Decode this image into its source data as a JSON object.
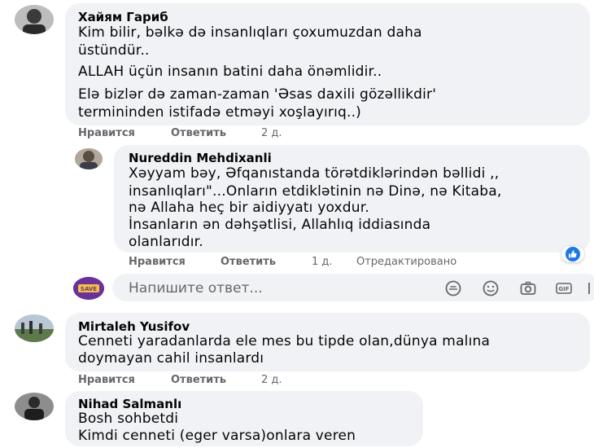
{
  "comments": [
    {
      "author": "Хайям Гариб",
      "lines": [
        "Kim bilir, bəlkə də insanlıqları çoxumuzdan daha",
        "üstündür..",
        "ALLAH üçün insanın batini daha önəmlidir..",
        "Elə bizlər də zaman-zaman 'Əsas daxili gözəllikdir'",
        "termininden istifadə etməyi xoşlayırıq..)"
      ],
      "actions": {
        "like": "Нравится",
        "reply": "Ответить",
        "time": "2 д."
      }
    },
    {
      "author": "Nureddin Mehdixanli",
      "lines": [
        "Xəyyam bəy, Əfqanıstanda törətdiklərindən bəllidi ,,",
        "insanlıqları\"...Onların etdiklətinin nə Dinə, nə Kitaba,",
        "nə Allaha heç bir aidiyyatı yoxdur.",
        "İnsanların ən dəhşətlisi, Allahlıq iddiasında",
        "olanlarıdır."
      ],
      "actions": {
        "like": "Нравится",
        "reply": "Ответить",
        "time": "1 д.",
        "edited": "Отредактировано"
      }
    },
    {
      "author": "Mirtaleh Yusifov",
      "lines": [
        "Cenneti yaradanlarda ele mes bu tipde olan,dünya malına",
        "doymayan cahil insanlardı"
      ],
      "actions": {
        "like": "Нравится",
        "reply": "Ответить",
        "time": "2 д."
      }
    },
    {
      "author": "Nihad Salmanlı",
      "lines": [
        "Bosh sohbetdi",
        "Kimdi cenneti (eger varsa)onlara veren"
      ]
    }
  ],
  "reply_box": {
    "placeholder": "Напишите ответ...",
    "avatar_text": "SAVE",
    "gif_label": "GIF"
  },
  "colors": {
    "bubble": "#f0f2f5",
    "like_blue": "#1877f2",
    "meta": "#65676b"
  }
}
